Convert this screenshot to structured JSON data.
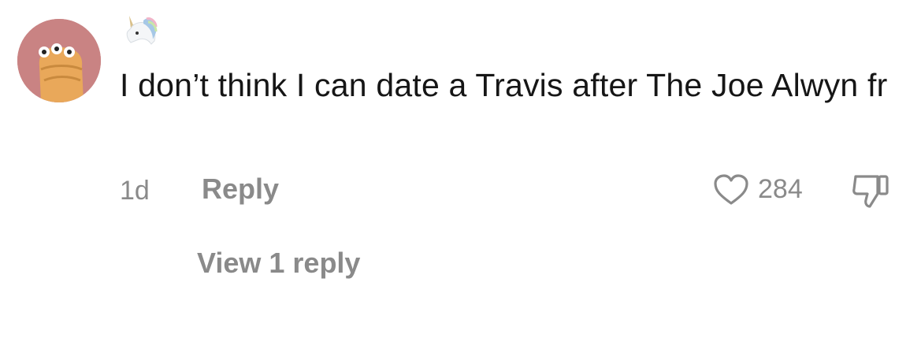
{
  "comment": {
    "user_emoji_icon": "unicorn-emoji-icon",
    "avatar_icon": "avatar-character-icon",
    "text": "I don’t think I can date a Travis after The Joe Alwyn fr",
    "time_ago": "1d",
    "reply_label": "Reply",
    "like_icon": "heart-outline-icon",
    "like_count": "284",
    "dislike_icon": "thumbs-down-outline-icon",
    "view_replies_label": "View 1 reply"
  },
  "colors": {
    "text_primary": "#161616",
    "text_secondary": "#8a8a8a",
    "avatar_background": "#c98383"
  }
}
